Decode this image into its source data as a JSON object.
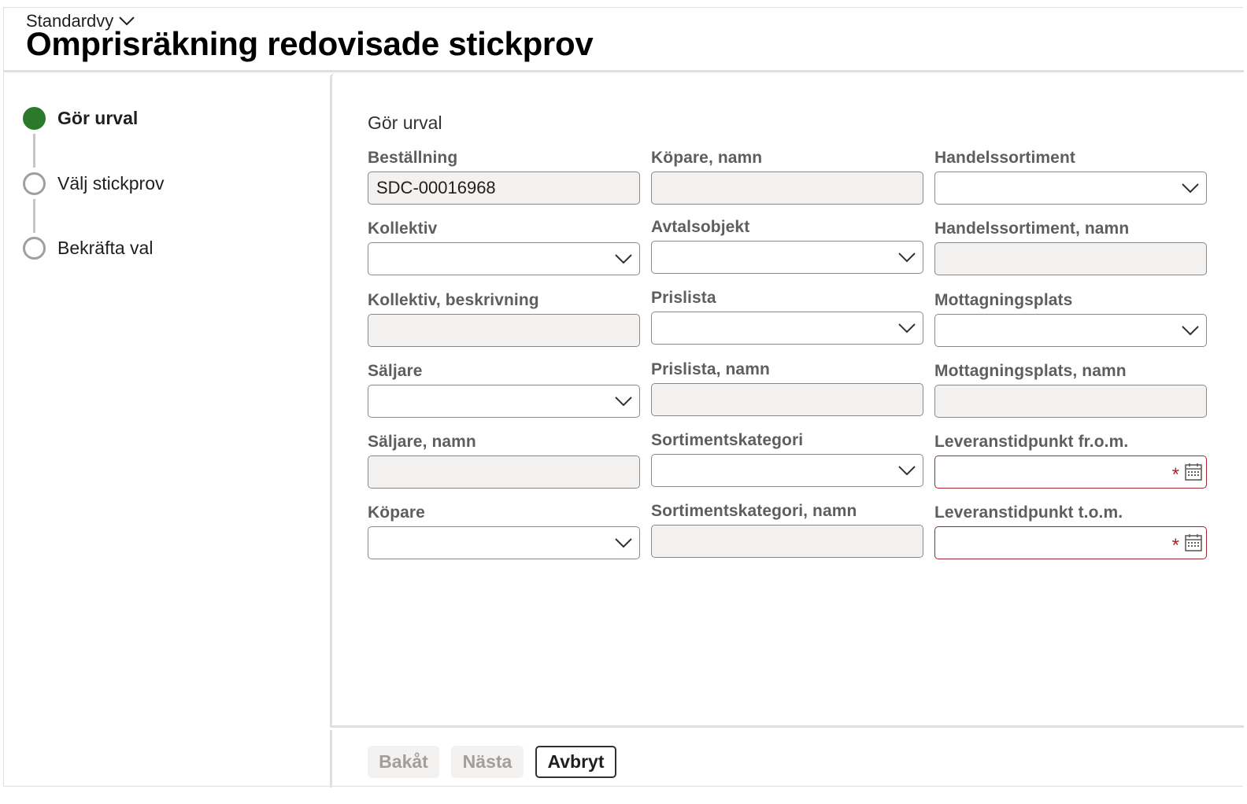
{
  "header": {
    "view_selector": "Standardvy",
    "title": "Omprisräkning redovisade stickprov"
  },
  "steps": [
    {
      "label": "Gör urval",
      "state": "active"
    },
    {
      "label": "Välj stickprov",
      "state": "pending"
    },
    {
      "label": "Bekräfta val",
      "state": "pending"
    }
  ],
  "form": {
    "section_title": "Gör urval",
    "fields": {
      "bestallning": {
        "label": "Beställning",
        "value": "SDC-00016968"
      },
      "kopare_namn": {
        "label": "Köpare, namn",
        "value": ""
      },
      "handelssortiment": {
        "label": "Handelssortiment",
        "value": ""
      },
      "kollektiv": {
        "label": "Kollektiv",
        "value": ""
      },
      "avtalsobjekt": {
        "label": "Avtalsobjekt",
        "value": ""
      },
      "handelssortiment_namn": {
        "label": "Handelssortiment, namn",
        "value": ""
      },
      "kollektiv_beskrivning": {
        "label": "Kollektiv, beskrivning",
        "value": ""
      },
      "prislista": {
        "label": "Prislista",
        "value": ""
      },
      "mottagningsplats": {
        "label": "Mottagningsplats",
        "value": ""
      },
      "saljare": {
        "label": "Säljare",
        "value": ""
      },
      "prislista_namn": {
        "label": "Prislista, namn",
        "value": ""
      },
      "mottagningsplats_namn": {
        "label": "Mottagningsplats, namn",
        "value": ""
      },
      "saljare_namn": {
        "label": "Säljare, namn",
        "value": ""
      },
      "sortimentskategori": {
        "label": "Sortimentskategori",
        "value": ""
      },
      "leverans_from": {
        "label": "Leveranstidpunkt fr.o.m.",
        "value": "",
        "required_mark": "*"
      },
      "kopare": {
        "label": "Köpare",
        "value": ""
      },
      "sortimentskategori_namn": {
        "label": "Sortimentskategori, namn",
        "value": ""
      },
      "leverans_tom": {
        "label": "Leveranstidpunkt t.o.m.",
        "value": "",
        "required_mark": "*"
      }
    }
  },
  "footer": {
    "back_label": "Bakåt",
    "next_label": "Nästa",
    "cancel_label": "Avbryt"
  },
  "colors": {
    "active_step": "#2b7a2b",
    "required_border": "#a4262c",
    "readonly_fill": "#f3f2f1"
  }
}
